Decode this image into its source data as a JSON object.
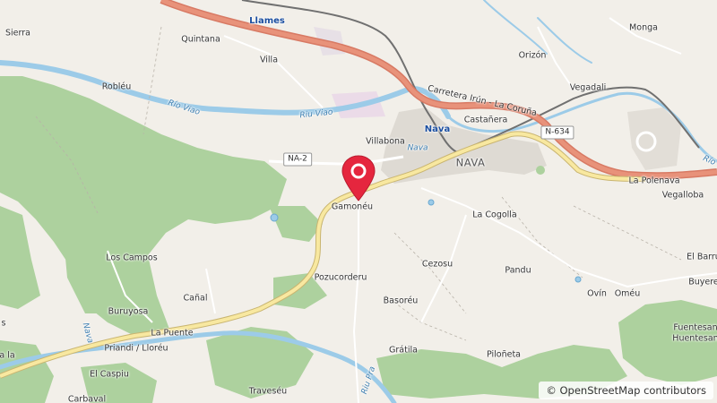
{
  "map": {
    "labels": {
      "sierra": "Sierra",
      "quintana": "Quintana",
      "llames": "Llames",
      "monga": "Monga",
      "villa": "Villa",
      "orizon": "Orizón",
      "robleu": "Robléu",
      "rio_viao_1": "Río Viao",
      "riu_viao": "Riu Viao",
      "carretera": "Carretera Irún - La Coruña",
      "vegadali": "Vegadali",
      "castanera": "Castañera",
      "nava_station": "Nava",
      "villabona": "Villabona",
      "nava_small": "Nava",
      "nava_town": "NAVA",
      "la_polenava": "La Polenava",
      "vegalloba": "Vegalloba",
      "gamoneu": "Gamonéu",
      "la_cogolla": "La Cogolla",
      "los_campos": "Los Campos",
      "cezosu": "Cezosu",
      "pandu": "Pandu",
      "el_barru": "El Barru",
      "pozucorderu": "Pozucorderu",
      "canal": "Cañal",
      "ovin": "Ovín",
      "omeu": "Oméu",
      "buyere": "Buyere",
      "buruyosa": "Buruyosa",
      "basoreu": "Basoréu",
      "la_puente": "La Puente",
      "fuentesanta": "Fuentesan",
      "huentesanta": "Huentesan",
      "priandi": "Priandi / Lloréu",
      "nava_river": "Nava",
      "s_left": "s",
      "a_la": "a la",
      "gratila": "Grátila",
      "piloneta": "Piloñeta",
      "el_caspiu": "El Caspiu",
      "carbaval": "Carbaval",
      "traveseu": "Traveséu",
      "riu_pra": "Riu Pra",
      "rio_right": "Río"
    },
    "shields": {
      "na2": "NA-2",
      "n634": "N-634"
    },
    "marker_icon": "map-pin-icon",
    "colors": {
      "forest": "#a8cc94",
      "river": "#9ccbe8",
      "highway": "#e8927a",
      "primary": "#f8e8a0",
      "marker": "#e5263e"
    }
  },
  "attribution": {
    "symbol": "©",
    "text": "OpenStreetMap contributors"
  }
}
